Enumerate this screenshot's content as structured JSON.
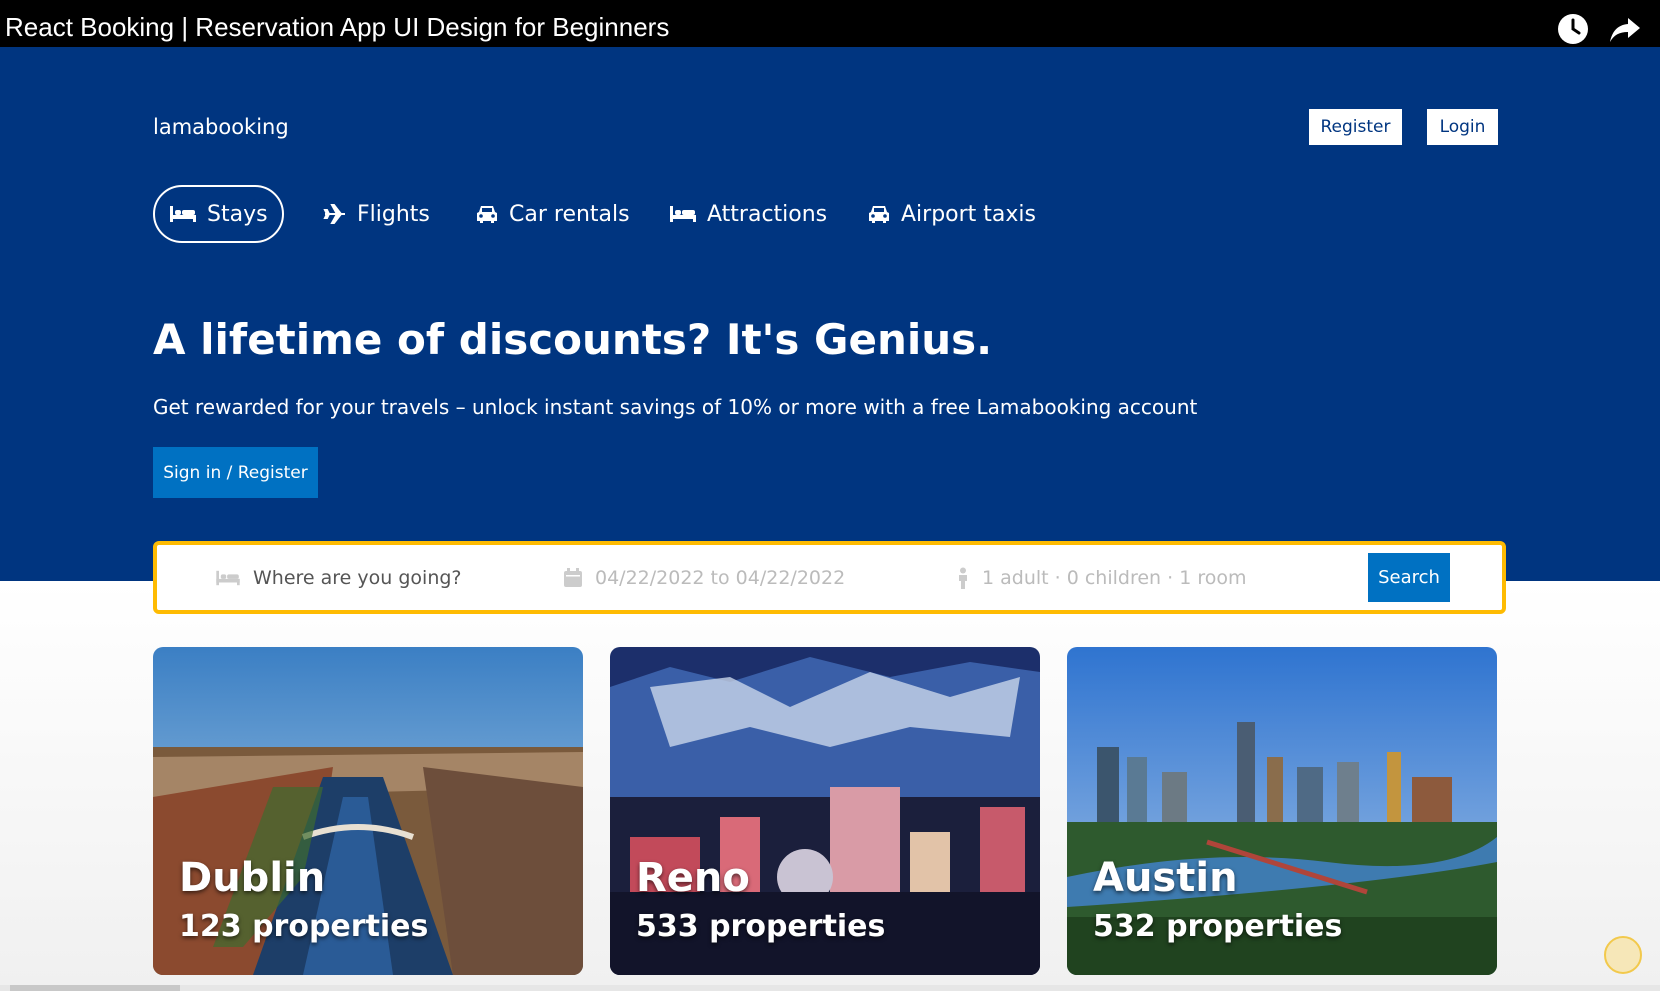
{
  "video": {
    "title": "React Booking | Reservation App UI Design for Beginners",
    "icons": [
      "watch-later-icon",
      "share-icon"
    ]
  },
  "navbar": {
    "logo": "lamabooking",
    "register_label": "Register",
    "login_label": "Login"
  },
  "header_tabs": [
    {
      "label": "Stays",
      "icon": "bed-icon",
      "active": true
    },
    {
      "label": "Flights",
      "icon": "plane-icon",
      "active": false
    },
    {
      "label": "Car rentals",
      "icon": "car-icon",
      "active": false
    },
    {
      "label": "Attractions",
      "icon": "bed-icon",
      "active": false
    },
    {
      "label": "Airport taxis",
      "icon": "taxi-icon",
      "active": false
    }
  ],
  "hero": {
    "headline": "A lifetime of discounts? It's Genius.",
    "subtext": "Get rewarded for your travels – unlock instant savings of 10% or more with a free Lamabooking account",
    "cta_label": "Sign in / Register"
  },
  "search": {
    "destination_placeholder": "Where are you going?",
    "dates": "04/22/2022 to 04/22/2022",
    "guests": "1 adult · 0 children · 1 room",
    "button_label": "Search"
  },
  "featured": [
    {
      "city": "Dublin",
      "properties": "123 properties"
    },
    {
      "city": "Reno",
      "properties": "533 properties"
    },
    {
      "city": "Austin",
      "properties": "532 properties"
    }
  ],
  "colors": {
    "brand_blue": "#003580",
    "button_blue": "#0071c2",
    "search_border": "#febb02"
  }
}
